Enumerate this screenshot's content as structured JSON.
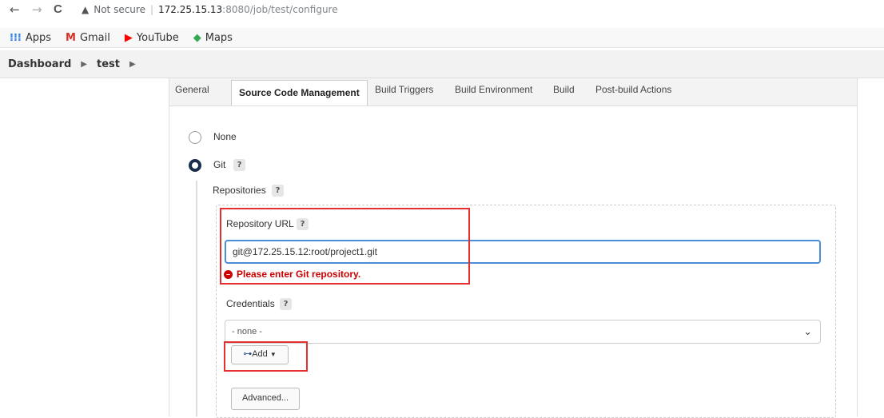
{
  "browser": {
    "back": "←",
    "forward": "→",
    "reload": "C",
    "security_text": "Not secure",
    "url_host": "172.25.15.13",
    "url_path": ":8080/job/test/configure"
  },
  "bookmarks": [
    {
      "icon": "apps-icon",
      "glyph": "⁞⁞⁞",
      "label": "Apps",
      "color": "#1a73e8"
    },
    {
      "icon": "gmail-icon",
      "glyph": "M",
      "label": "Gmail",
      "color": "#d93025"
    },
    {
      "icon": "youtube-icon",
      "glyph": "▶",
      "label": "YouTube",
      "color": "#ff0000"
    },
    {
      "icon": "maps-icon",
      "glyph": "◆",
      "label": "Maps",
      "color": "#34a853"
    }
  ],
  "breadcrumb": [
    "Dashboard",
    "test"
  ],
  "tabs": [
    "General",
    "Source Code Management",
    "Build Triggers",
    "Build Environment",
    "Build",
    "Post-build Actions"
  ],
  "active_tab": "Source Code Management",
  "scm": {
    "none_label": "None",
    "git_label": "Git",
    "help": "?",
    "repositories_label": "Repositories",
    "repo_url_label": "Repository URL",
    "repo_url_value": "git@172.25.15.12:root/project1.git",
    "error_text": "Please enter Git repository.",
    "credentials_label": "Credentials",
    "credentials_value": "- none -",
    "add_label": "Add",
    "advanced_label": "Advanced..."
  },
  "colors": {
    "error": "#cc0000",
    "highlight": "#e53030",
    "radio_checked": "#1a2f4d"
  }
}
